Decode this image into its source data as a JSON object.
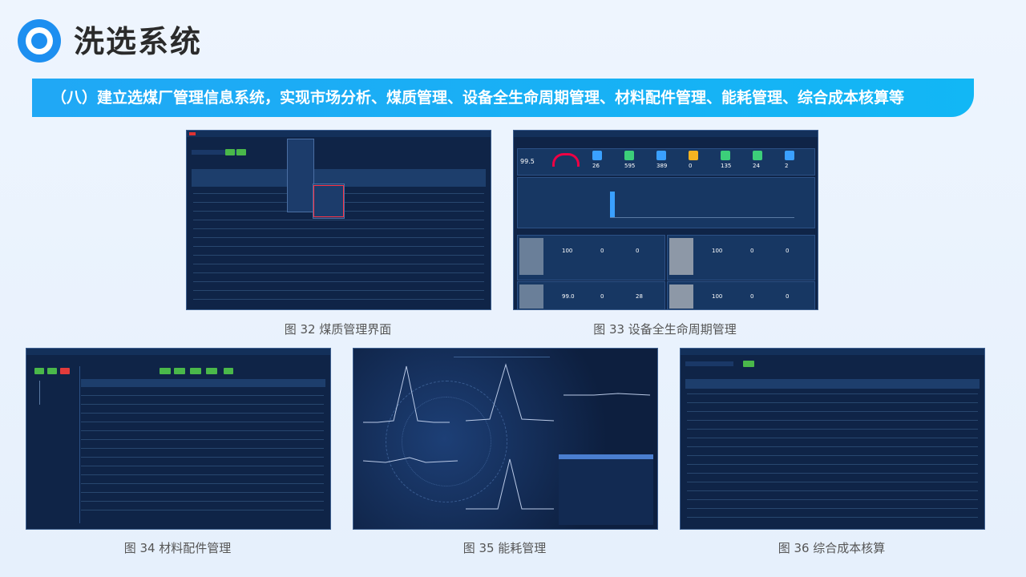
{
  "header": {
    "title": "洗选系统",
    "banner": "（八）建立选煤厂管理信息系统，实现市场分析、煤质管理、设备全生命周期管理、材料配件管理、能耗管理、综合成本核算等"
  },
  "figures": [
    {
      "caption": "图 32 煤质管理界面"
    },
    {
      "caption": "图 33 设备全生命周期管理"
    },
    {
      "caption": "图 34 材料配件管理"
    },
    {
      "caption": "图 35 能耗管理"
    },
    {
      "caption": "图 36 综合成本核算"
    }
  ],
  "fig33_stats": [
    "99.5",
    "26",
    "595",
    "389",
    "0",
    "135",
    "24",
    "2"
  ],
  "fig33_cards": [
    "100",
    "0",
    "0",
    "100",
    "0",
    "0",
    "99.0",
    "0",
    "28",
    "100",
    "0",
    "0"
  ],
  "colors": {
    "banner": "#1aaef5",
    "accent": "#1d8ff0",
    "screen_bg": "#0f2447",
    "green_button": "#4ab84a",
    "red_button": "#e23b3b"
  }
}
